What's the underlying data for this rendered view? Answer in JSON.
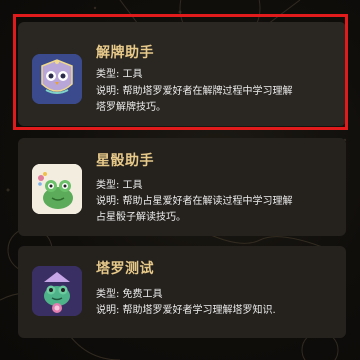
{
  "cards": [
    {
      "title": "解牌助手",
      "type_line": "类型: 工具",
      "desc_line1": "说明: 帮助塔罗爱好者在解牌过程中学习理解",
      "desc_line2": "塔罗解牌技巧。",
      "icon": "tarot-owl-icon",
      "highlighted": true
    },
    {
      "title": "星骰助手",
      "type_line": "类型: 工具",
      "desc_line1": "说明: 帮助占星爱好者在解读过程中学习理解",
      "desc_line2": "占星骰子解读技巧。",
      "icon": "frog-wizard-icon"
    },
    {
      "title": "塔罗测试",
      "type_line": "类型: 免费工具",
      "desc_line1": "说明: 帮助塔罗爱好者学习理解塔罗知识.",
      "icon": "frog-crystal-icon"
    }
  ],
  "colors": {
    "title": "#e7c98a",
    "text": "#ededed",
    "card": "#25221e",
    "highlight": "#e11b1b"
  }
}
